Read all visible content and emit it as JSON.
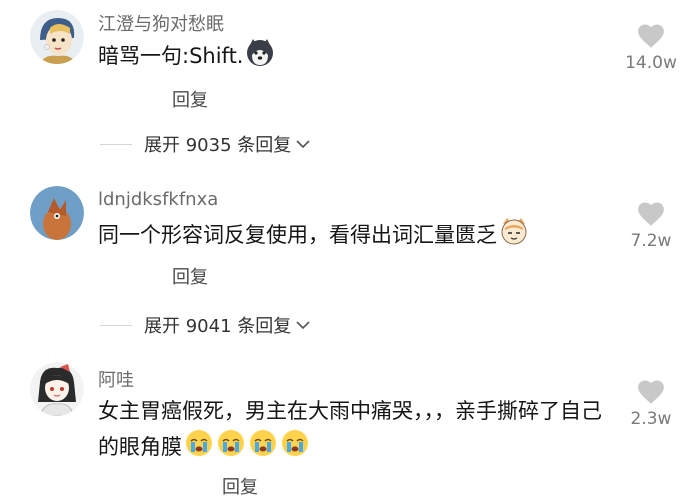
{
  "comments": [
    {
      "username": "江澄与狗对愁眠",
      "text": "暗骂一句:Shift.",
      "emoji": "husky-face-emoji",
      "likes": "14.0w",
      "reply_label": "回复",
      "expand_label": "展开 9035 条回复"
    },
    {
      "username": "ldnjdksfkfnxa",
      "text": "同一个形容词反复使用，看得出词汇量匮乏",
      "emoji": "cat-face-emoji",
      "likes": "7.2w",
      "reply_label": "回复",
      "expand_label": "展开 9041 条回复"
    },
    {
      "username": "阿哇",
      "text": "女主胃癌假死，男主在大雨中痛哭，，，亲手撕碎了自己的眼角膜",
      "emoji": "crying-face-emoji",
      "likes": "2.3w",
      "reply_label": "回复"
    }
  ],
  "colors": {
    "heart": "#c8c8c8",
    "username": "#6b6b6b",
    "background": "#ffffff"
  },
  "icons": [
    "heart-icon",
    "chevron-down-icon"
  ]
}
